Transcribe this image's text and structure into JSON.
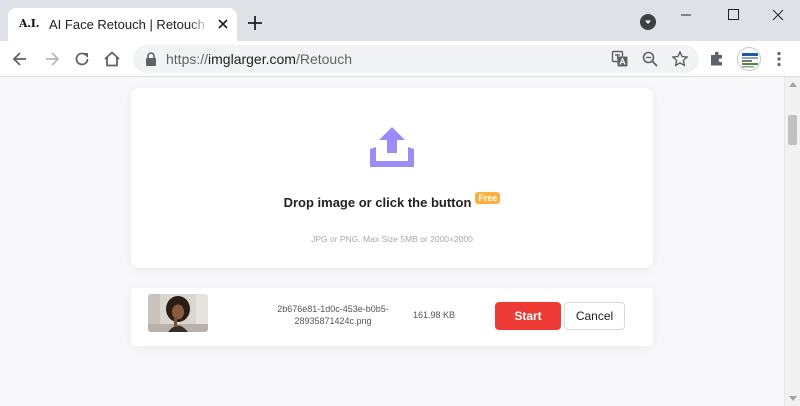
{
  "browser": {
    "tab": {
      "favicon_text": "A.I.",
      "title": "AI Face Retouch | Retouch and"
    },
    "address_bar": {
      "scheme": "https://",
      "host": "imglarger.com",
      "path": "/Retouch"
    },
    "icons": {
      "close_tab": "close-icon",
      "new_tab": "plus-icon",
      "tab_search": "chevron-down-icon",
      "back": "arrow-left-icon",
      "forward": "arrow-right-icon",
      "reload": "reload-icon",
      "home": "home-icon",
      "lock": "lock-icon",
      "translate": "translate-icon",
      "zoom": "zoom-icon",
      "bookmark": "star-icon",
      "extensions": "puzzle-icon",
      "menu": "kebab-menu-icon"
    }
  },
  "upload": {
    "icon": "upload-tray-icon",
    "icon_color": "#9b8cf7",
    "drop_text": "Drop image or click the button",
    "badge": "Free",
    "badge_color": "#fbb13c",
    "hint": "JPG or PNG. Max Size 5MB or 2000×2000"
  },
  "file": {
    "name_line1": "2b676e81-1d0c-453e-b0b5-",
    "name_line2": "28935871424c.png",
    "size": "161.98 KB",
    "start_label": "Start",
    "start_color": "#ef3b36",
    "cancel_label": "Cancel"
  }
}
